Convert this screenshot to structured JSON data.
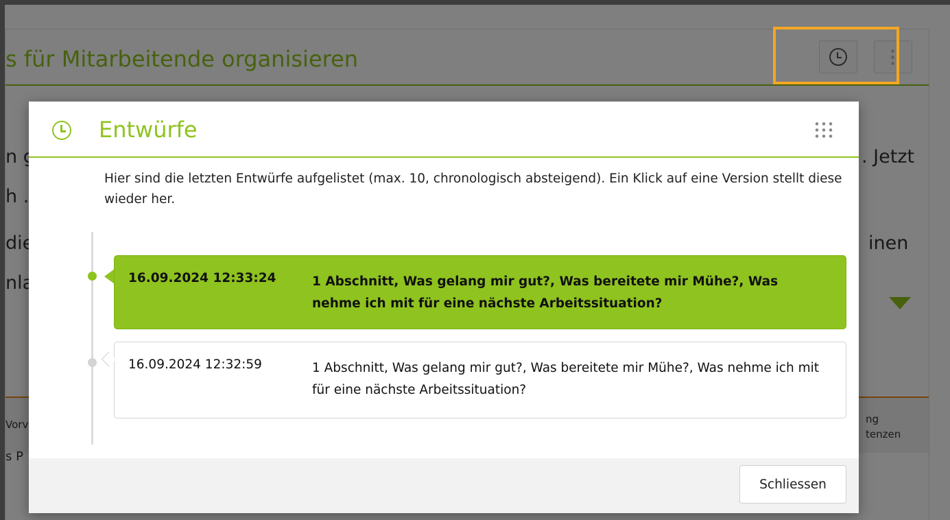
{
  "background_page": {
    "title": "s für Mitarbeitende organisieren",
    "text_line_1_right": ". Jetzt",
    "text_line_1_left": "n g",
    "text_line_2_left": "h .",
    "text_line_3_left": "die",
    "text_line_3_right": "inen",
    "text_line_4_left": "nla",
    "tab_left": "Vorv",
    "tab_right_1": "ng",
    "tab_right_2": "tenzen",
    "row_left": "s P"
  },
  "modal": {
    "title": "Entwürfe",
    "description": "Hier sind die letzten Entwürfe aufgelistet (max. 10, chronologisch absteigend). Ein Klick auf eine Version stellt diese wieder her.",
    "entries": [
      {
        "date": "16.09.2024 12:33:24",
        "text": "1 Abschnitt, Was gelang mir gut?, Was bereitete mir Mühe?, Was nehme ich mit für eine nächste Arbeitssituation?"
      },
      {
        "date": "16.09.2024 12:32:59",
        "text": "1 Abschnitt, Was gelang mir gut?, Was bereitete mir Mühe?, Was nehme ich mit für eine nächste Arbeitssituation?"
      }
    ],
    "close_label": "Schliessen"
  },
  "colors": {
    "accent_green": "#8fc31f",
    "highlight_orange": "#f5a623"
  },
  "icons": [
    "clock-icon",
    "more-vertical-icon",
    "grid-icon"
  ]
}
